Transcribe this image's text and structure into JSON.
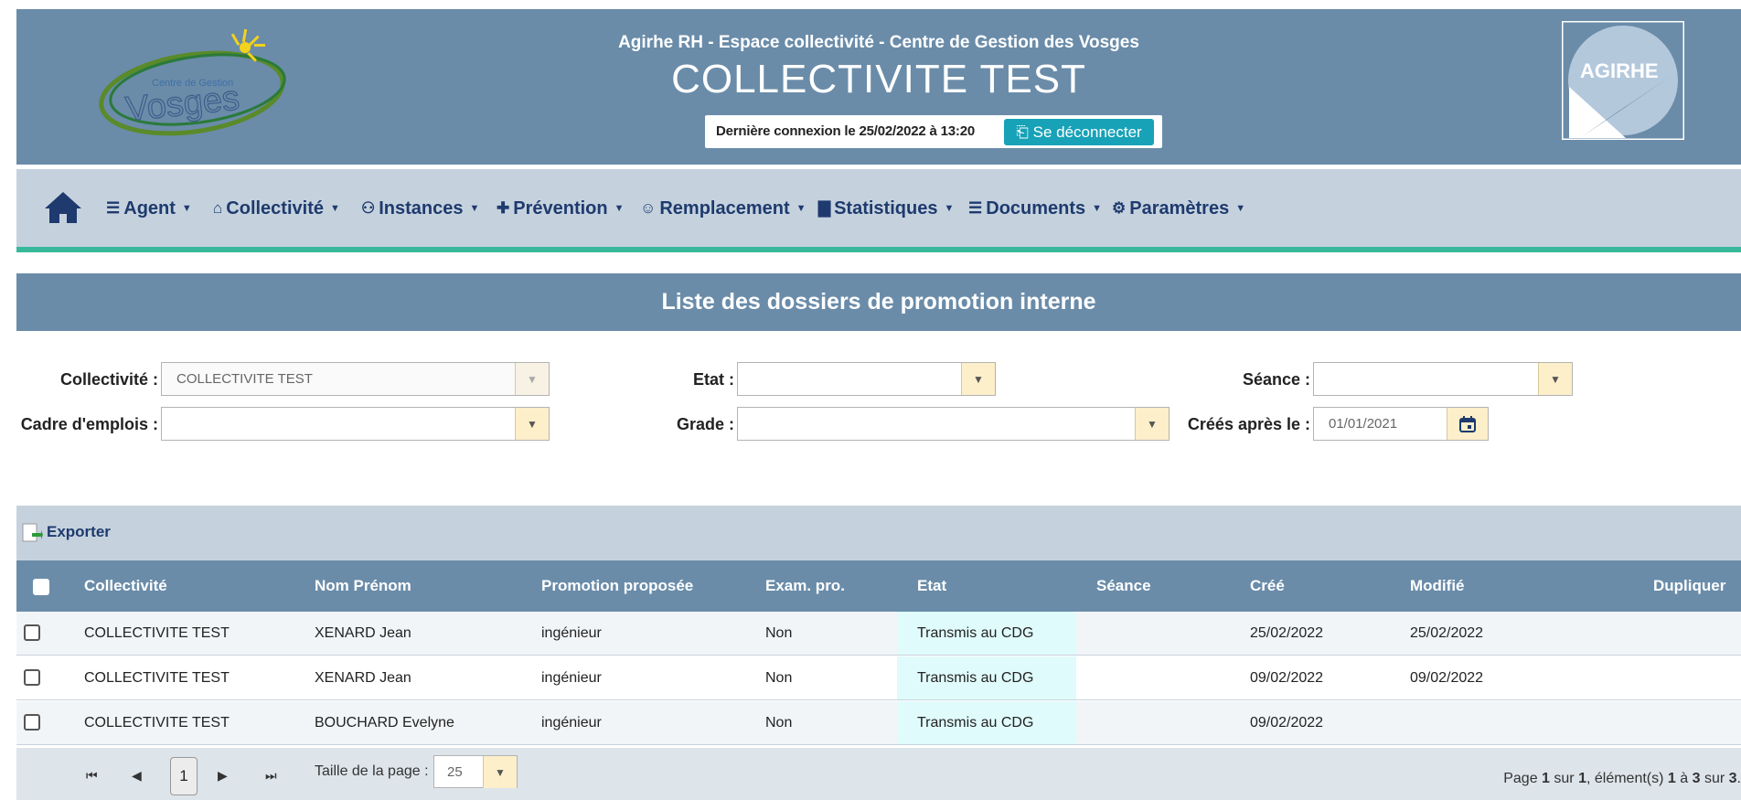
{
  "header": {
    "subtitle": "Agirhe RH - Espace collectivité - Centre de Gestion des Vosges",
    "title": "COLLECTIVITE TEST",
    "last_login": "Dernière connexion le 25/02/2022 à 13:20",
    "logout_label": "Se déconnecter",
    "logo_left_text": "Vosges",
    "logo_left_small": "Centre de Gestion",
    "logo_right_text": "AGIRHE"
  },
  "nav": {
    "items": [
      {
        "label": "Agent",
        "icon": "users-icon"
      },
      {
        "label": "Collectivité",
        "icon": "bank-icon"
      },
      {
        "label": "Instances",
        "icon": "handshake-icon"
      },
      {
        "label": "Prévention",
        "icon": "medkit-icon"
      },
      {
        "label": "Remplacement",
        "icon": "user-cog-icon"
      },
      {
        "label": "Statistiques",
        "icon": "bar-chart-icon"
      },
      {
        "label": "Documents",
        "icon": "file-icon"
      },
      {
        "label": "Paramètres",
        "icon": "cogs-icon"
      }
    ]
  },
  "panel": {
    "title": "Liste des dossiers de promotion interne"
  },
  "filters": {
    "collectivite_label": "Collectivité :",
    "collectivite_value": "COLLECTIVITE TEST",
    "etat_label": "Etat :",
    "etat_value": "",
    "seance_label": "Séance :",
    "seance_value": "",
    "cadre_label": "Cadre d'emplois :",
    "cadre_value": "",
    "grade_label": "Grade :",
    "grade_value": "",
    "crees_label": "Créés après le :",
    "crees_value": "01/01/2021"
  },
  "toolbar": {
    "export_label": "Exporter"
  },
  "table": {
    "columns": [
      "Collectivité",
      "Nom Prénom",
      "Promotion proposée",
      "Exam. pro.",
      "Etat",
      "Séance",
      "Créé",
      "Modifié",
      "Dupliquer"
    ],
    "rows": [
      [
        "COLLECTIVITE TEST",
        "XENARD Jean",
        "ingénieur",
        "Non",
        "Transmis au CDG",
        "",
        "25/02/2022",
        "25/02/2022",
        ""
      ],
      [
        "COLLECTIVITE TEST",
        "XENARD Jean",
        "ingénieur",
        "Non",
        "Transmis au CDG",
        "",
        "09/02/2022",
        "09/02/2022",
        ""
      ],
      [
        "COLLECTIVITE TEST",
        "BOUCHARD Evelyne",
        "ingénieur",
        "Non",
        "Transmis au CDG",
        "",
        "09/02/2022",
        "",
        ""
      ]
    ]
  },
  "pager": {
    "current_page": "1",
    "page_size_label": "Taille de la page :",
    "page_size": "25",
    "info_prefix": "Page ",
    "info_page": "1",
    "info_sur": " sur ",
    "info_total_pages": "1",
    "info_elements": ", élément(s) ",
    "info_from": "1",
    "info_a": " à ",
    "info_to": "3",
    "info_sur2": " sur ",
    "info_total": "3",
    "info_end": "."
  },
  "colors": {
    "header_bg": "#6a8ca9",
    "nav_bg": "#c5d2de",
    "accent_teal": "#37b89b",
    "button_info": "#17a2b8",
    "etat_bg": "#e0fbfc"
  }
}
